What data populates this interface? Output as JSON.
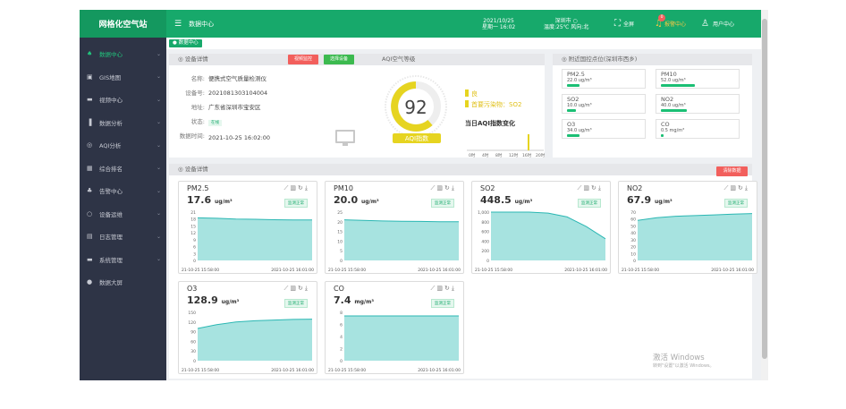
{
  "app": {
    "logo": "网格化空气站",
    "menu_title": "数据中心",
    "date": "2021/10/25",
    "weekday_time": "星期一 16:02",
    "city": "深圳市",
    "weather": "温度:25℃ 风向:北",
    "fullscreen": "全屏",
    "alarm_count": "0",
    "alarm_label": "报警中心",
    "user_label": "用户中心",
    "active_tab": "数据中心"
  },
  "sidebar": [
    {
      "label": "数据中心"
    },
    {
      "label": "GIS地图"
    },
    {
      "label": "视频中心"
    },
    {
      "label": "数据分析"
    },
    {
      "label": "AQI分析"
    },
    {
      "label": "综合排名"
    },
    {
      "label": "告警中心"
    },
    {
      "label": "设备运维"
    },
    {
      "label": "日志管理"
    },
    {
      "label": "系统管理"
    },
    {
      "label": "数据大屏"
    }
  ],
  "device": {
    "header": "设备详情",
    "btn_video": "视频监控",
    "btn_select": "选择设备",
    "name_k": "名称:",
    "name_v": "便携式空气质量检测仪",
    "id_k": "设备号:",
    "id_v": "2021081303104004",
    "addr_k": "地址:",
    "addr_v": "广东省深圳市宝安区",
    "status_k": "状态:",
    "status_v": "在线",
    "time_k": "数据时间:",
    "time_v": "2021-10-25 16:02:00"
  },
  "aqi": {
    "header": "AQI空气等级",
    "value": "92",
    "label": "AQI指数",
    "level": "良",
    "primary": "首要污染物：SO2",
    "trend_title": "当日AQI指数变化",
    "hours": [
      "0时",
      "4时",
      "8时",
      "12时",
      "16时",
      "20时"
    ]
  },
  "national": {
    "header": "附近国控点位(深圳市西乡)",
    "items": [
      {
        "name": "PM2.5",
        "value": "22.0 ug/m³",
        "level": 0.18
      },
      {
        "name": "PM10",
        "value": "52.0 ug/m³",
        "level": 0.48
      },
      {
        "name": "SO2",
        "value": "10.0 ug/m³",
        "level": 0.12
      },
      {
        "name": "NO2",
        "value": "40.0 ug/m³",
        "level": 0.36
      },
      {
        "name": "O3",
        "value": "34.0 ug/m³",
        "level": 0.18
      },
      {
        "name": "CO",
        "value": "0.5 mg/m³",
        "level": 0.02
      }
    ]
  },
  "detail": {
    "header": "设备详情",
    "clear_btn": "清除数据",
    "status": "监测正常",
    "x_start": "21-10-25 15:58:00",
    "x_end": "2021-10-25 16:01:00"
  },
  "metrics": [
    {
      "name": "PM2.5",
      "value": "17.6",
      "unit": "ug/m³",
      "yticks": [
        "21",
        "18",
        "15",
        "12",
        "9",
        "6",
        "3",
        "0"
      ],
      "ymax": 21,
      "series": [
        18.5,
        18.3,
        18.0,
        17.9,
        17.7,
        17.6,
        17.6
      ]
    },
    {
      "name": "PM10",
      "value": "20.0",
      "unit": "ug/m³",
      "yticks": [
        "25",
        "20",
        "15",
        "10",
        "5",
        "0"
      ],
      "ymax": 25,
      "series": [
        21.0,
        20.7,
        20.4,
        20.3,
        20.2,
        20.0,
        20.0
      ]
    },
    {
      "name": "SO2",
      "value": "448.5",
      "unit": "ug/m³",
      "yticks": [
        "1,000",
        "800",
        "600",
        "400",
        "200",
        "0"
      ],
      "ymax": 1000,
      "series": [
        1000,
        1000,
        1000,
        980,
        900,
        700,
        448.5
      ]
    },
    {
      "name": "NO2",
      "value": "67.9",
      "unit": "ug/m³",
      "yticks": [
        "70",
        "60",
        "50",
        "40",
        "30",
        "20",
        "10",
        "0"
      ],
      "ymax": 70,
      "series": [
        58,
        62,
        64,
        65,
        66,
        67,
        67.9
      ]
    },
    {
      "name": "O3",
      "value": "128.9",
      "unit": "ug/m³",
      "yticks": [
        "150",
        "120",
        "90",
        "60",
        "30",
        "0"
      ],
      "ymax": 150,
      "series": [
        100,
        112,
        120,
        124,
        126,
        128,
        128.9
      ]
    },
    {
      "name": "CO",
      "value": "7.4",
      "unit": "mg/m³",
      "yticks": [
        "8",
        "6",
        "4",
        "2",
        "0"
      ],
      "ymax": 8,
      "series": [
        7.4,
        7.4,
        7.4,
        7.4,
        7.4,
        7.4,
        7.4
      ]
    }
  ],
  "watermark": {
    "line1": "激活 Windows",
    "line2": "转到\"设置\"以激活 Windows。"
  },
  "colors": {
    "green": "#17a96b",
    "red": "#f25f5c",
    "yellow": "#e6d420",
    "chart_fill": "#a7e3e0",
    "chart_line": "#2bb7b3"
  },
  "icons": {
    "menu": "menu-icon",
    "alarm": "bell-icon",
    "user": "user-icon",
    "fullscreen": "fullscreen-icon"
  }
}
